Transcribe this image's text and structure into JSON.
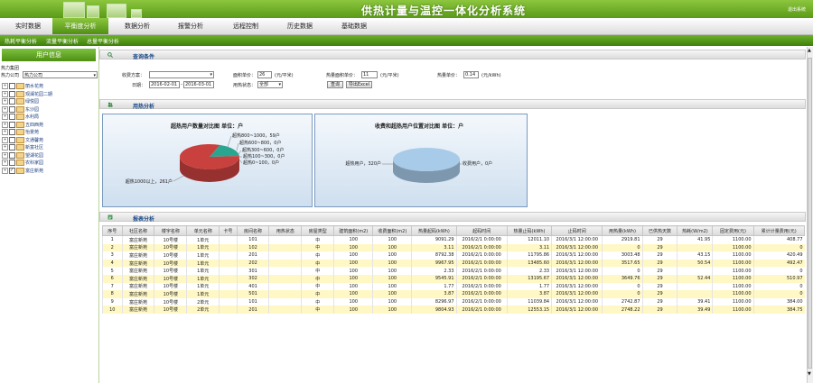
{
  "app_title": "供热计量与温控一体化分析系统",
  "exit_label": "退出系统",
  "nav_tabs": [
    "实时数据",
    "平衡度分析",
    "数据分析",
    "报警分析",
    "远程控制",
    "历史数据",
    "基础数据"
  ],
  "active_tab": 1,
  "sub_links": [
    "热耗平衡分析",
    "流量平衡分析",
    "总量平衡分析"
  ],
  "left": {
    "title": "用户信息",
    "group_label": "热力集团",
    "company_label": "热力公司",
    "company_value": "热力公司",
    "tree": [
      {
        "name": "丽水花苑",
        "checked": false
      },
      {
        "name": "观澜花园二期",
        "checked": false
      },
      {
        "name": "绿悦园",
        "checked": false
      },
      {
        "name": "东沙园",
        "checked": false
      },
      {
        "name": "水利局",
        "checked": false
      },
      {
        "name": "五四西苑",
        "checked": false
      },
      {
        "name": "怡景苑",
        "checked": false
      },
      {
        "name": "文通馨苑",
        "checked": false
      },
      {
        "name": "新富社区",
        "checked": false
      },
      {
        "name": "望湖花园",
        "checked": false
      },
      {
        "name": "农科家园",
        "checked": false
      },
      {
        "name": "富庄新苑",
        "checked": true
      }
    ]
  },
  "query": {
    "section_title": "查询条件",
    "charge_label": "收费方案：",
    "charge_value": "",
    "date_label": "日期：",
    "date_from": "2016-02-01",
    "date_sep": "-",
    "date_to": "2016-03-01",
    "area_label": "面积单价：",
    "area_value": "26",
    "area_unit": "(元/平米)",
    "status_label": "用热状态：",
    "status_value": "全部",
    "heat_area_label": "热量面积单价：",
    "heat_area_value": "11",
    "heat_area_unit": "(元/平米)",
    "heat_price_label": "热量单价：",
    "heat_price_value": "0.14",
    "heat_price_unit": "(元/kWh)",
    "search_btn": "查询",
    "export_btn": "导出Excel"
  },
  "usage_section_title": "用热分析",
  "chart_data": [
    {
      "type": "pie",
      "title": "超热用户数量对比图 单位：户",
      "labels": [
        "超热800~1000，59户",
        "超热600~800，0户",
        "超热300~600，0户",
        "超热100~300，0户",
        "超热0~100，0户",
        "超热1000以上，261户"
      ],
      "values": [
        59,
        0,
        0,
        0,
        0,
        261
      ],
      "colors": [
        "#2aa690",
        "#ff3030",
        "#ffaa00",
        "#3060d0",
        "#a0a0a0",
        "#c8413e"
      ]
    },
    {
      "type": "pie",
      "title": "收费和超热用户位置对比图 单位：户",
      "labels": [
        "超热用户，320户",
        "收费用户，0户"
      ],
      "values": [
        320,
        0
      ],
      "colors": [
        "#a7cbe8",
        "#5a8fc4"
      ]
    }
  ],
  "report": {
    "section_title": "报表分析",
    "headers": [
      "序号",
      "社区名称",
      "楼宇名称",
      "单元名称",
      "卡号",
      "房间名称",
      "用热状态",
      "房屋类型",
      "建筑面积(m2)",
      "收费面积(m2)",
      "热量起码(kWh)",
      "起码时间",
      "热量止码(kWh)",
      "止码时间",
      "用热量(kWh)",
      "已供热天数",
      "热耗(W/m2)",
      "固定费用(元)",
      "累计计量费用(元)"
    ],
    "rows": [
      [
        "1",
        "富庄新苑",
        "10号楼",
        "1单元",
        "",
        "101",
        "",
        "中",
        "100",
        "100",
        "9091.29",
        "2016/2/1 0:00:00",
        "12011.10",
        "2016/3/1 12:00:00",
        "2919.81",
        "29",
        "41.95",
        "1100.00",
        "408.77"
      ],
      [
        "2",
        "富庄新苑",
        "10号楼",
        "1单元",
        "",
        "102",
        "",
        "中",
        "100",
        "100",
        "3.11",
        "2016/2/1 0:00:00",
        "3.11",
        "2016/3/1 12:00:00",
        "0",
        "29",
        "",
        "1100.00",
        "0"
      ],
      [
        "3",
        "富庄新苑",
        "10号楼",
        "1单元",
        "",
        "201",
        "",
        "中",
        "100",
        "100",
        "8792.38",
        "2016/2/1 0:00:00",
        "11795.86",
        "2016/3/1 12:00:00",
        "3003.48",
        "29",
        "43.15",
        "1100.00",
        "420.49"
      ],
      [
        "4",
        "富庄新苑",
        "10号楼",
        "1单元",
        "",
        "202",
        "",
        "中",
        "100",
        "100",
        "9967.95",
        "2016/2/1 0:00:00",
        "13485.60",
        "2016/3/1 12:00:00",
        "3517.65",
        "29",
        "50.54",
        "1100.00",
        "492.47"
      ],
      [
        "5",
        "富庄新苑",
        "10号楼",
        "1单元",
        "",
        "301",
        "",
        "中",
        "100",
        "100",
        "2.33",
        "2016/2/1 0:00:00",
        "2.33",
        "2016/3/1 12:00:00",
        "0",
        "29",
        "",
        "1100.00",
        "0"
      ],
      [
        "6",
        "富庄新苑",
        "10号楼",
        "1单元",
        "",
        "302",
        "",
        "中",
        "100",
        "100",
        "9545.91",
        "2016/2/1 0:00:00",
        "13195.67",
        "2016/3/1 12:00:00",
        "3649.76",
        "29",
        "52.44",
        "1100.00",
        "510.97"
      ],
      [
        "7",
        "富庄新苑",
        "10号楼",
        "1单元",
        "",
        "401",
        "",
        "中",
        "100",
        "100",
        "1.77",
        "2016/2/1 0:00:00",
        "1.77",
        "2016/3/1 12:00:00",
        "0",
        "29",
        "",
        "1100.00",
        "0"
      ],
      [
        "8",
        "富庄新苑",
        "10号楼",
        "1单元",
        "",
        "501",
        "",
        "中",
        "100",
        "100",
        "3.87",
        "2016/2/1 0:00:00",
        "3.87",
        "2016/3/1 12:00:00",
        "0",
        "29",
        "",
        "1100.00",
        "0"
      ],
      [
        "9",
        "富庄新苑",
        "10号楼",
        "2单元",
        "",
        "101",
        "",
        "中",
        "100",
        "100",
        "8296.97",
        "2016/2/1 0:00:00",
        "11039.84",
        "2016/3/1 12:00:00",
        "2742.87",
        "29",
        "39.41",
        "1100.00",
        "384.00"
      ],
      [
        "10",
        "富庄新苑",
        "10号楼",
        "2单元",
        "",
        "201",
        "",
        "中",
        "100",
        "100",
        "9804.93",
        "2016/2/1 0:00:00",
        "12553.15",
        "2016/3/1 12:00:00",
        "2748.22",
        "29",
        "39.49",
        "1100.00",
        "384.75"
      ]
    ]
  }
}
